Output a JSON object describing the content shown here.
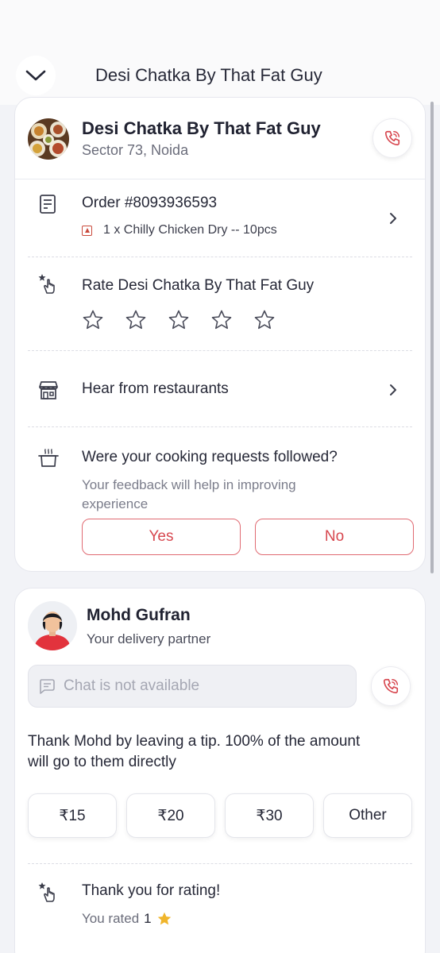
{
  "header": {
    "title": "Desi Chatka By That Fat Guy"
  },
  "restaurant": {
    "name": "Desi Chatka By That Fat Guy",
    "location": "Sector 73, Noida"
  },
  "order": {
    "number": "Order #8093936593",
    "items": "1 x Chilly Chicken Dry -- 10pcs"
  },
  "rating": {
    "title": "Rate Desi Chatka By That Fat Guy",
    "star_count": 5
  },
  "hear": {
    "label": "Hear from restaurants"
  },
  "cooking": {
    "question": "Were your cooking requests followed?",
    "subtext": "Your feedback will help in improving experience",
    "yes_label": "Yes",
    "no_label": "No"
  },
  "partner": {
    "name": "Mohd Gufran",
    "role": "Your delivery partner",
    "chat_placeholder": "Chat is not available"
  },
  "tip": {
    "message": "Thank Mohd by leaving a tip. 100% of the amount will go to them directly",
    "options": [
      "₹15",
      "₹20",
      "₹30",
      "Other"
    ]
  },
  "thanks": {
    "title": "Thank you for rating!",
    "rated_prefix": "You rated",
    "rated_value": "1"
  },
  "colors": {
    "accent": "#d7474f",
    "star_gold": "#f0b52b"
  }
}
